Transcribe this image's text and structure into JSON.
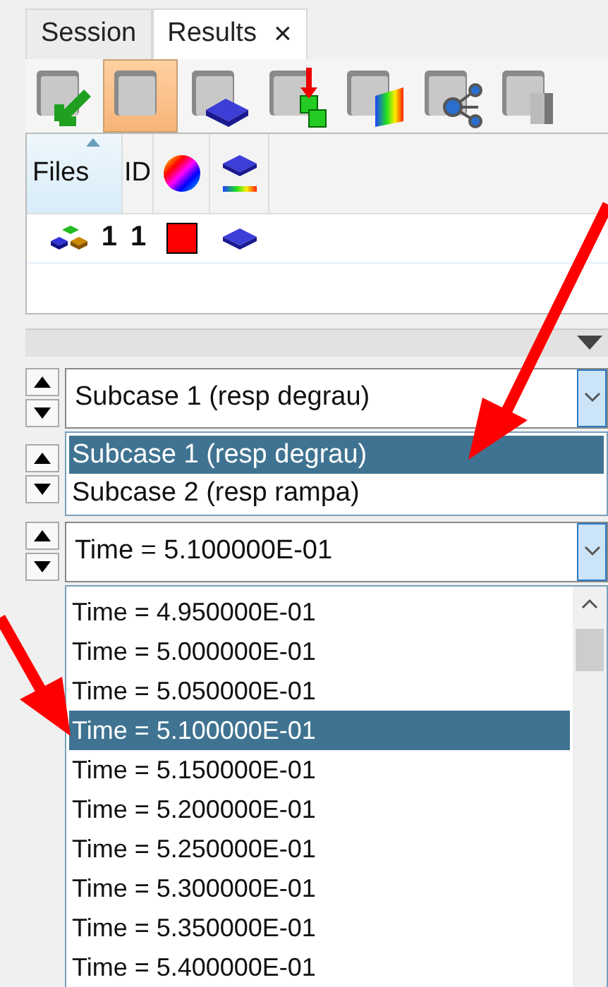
{
  "tabs": [
    {
      "label": "Session",
      "selected": false
    },
    {
      "label": "Results",
      "selected": true,
      "close": "×"
    }
  ],
  "toolbar": [
    {
      "kind": "load",
      "selected": false
    },
    {
      "kind": "folder",
      "selected": true
    },
    {
      "kind": "layer",
      "selected": false
    },
    {
      "kind": "add",
      "selected": false
    },
    {
      "kind": "contour",
      "selected": false
    },
    {
      "kind": "network",
      "selected": false
    },
    {
      "kind": "cube",
      "selected": false
    }
  ],
  "table": {
    "columns": [
      {
        "kind": "text",
        "label": "Files",
        "sorted": true
      },
      {
        "kind": "text",
        "label": "ID"
      },
      {
        "kind": "color"
      },
      {
        "kind": "display"
      }
    ],
    "rows": [
      {
        "file": "1",
        "id": "1",
        "color": "#ff0000"
      }
    ]
  },
  "subcase": {
    "value": "Subcase 1 (resp degrau)",
    "options": [
      {
        "label": "Subcase 1 (resp degrau)",
        "selected": true,
        "arrow": true
      },
      {
        "label": "Subcase 2 (resp rampa)",
        "selected": false,
        "arrow": false
      }
    ]
  },
  "time": {
    "value": "Time = 5.100000E-01",
    "options": [
      {
        "label": "Time = 4.950000E-01",
        "selected": false
      },
      {
        "label": "Time = 5.000000E-01",
        "selected": false
      },
      {
        "label": "Time = 5.050000E-01",
        "selected": false
      },
      {
        "label": "Time = 5.100000E-01",
        "selected": true,
        "arrow": true
      },
      {
        "label": "Time = 5.150000E-01",
        "selected": false
      },
      {
        "label": "Time = 5.200000E-01",
        "selected": false
      },
      {
        "label": "Time = 5.250000E-01",
        "selected": false
      },
      {
        "label": "Time = 5.300000E-01",
        "selected": false
      },
      {
        "label": "Time = 5.350000E-01",
        "selected": false
      },
      {
        "label": "Time = 5.400000E-01",
        "selected": false
      }
    ]
  }
}
